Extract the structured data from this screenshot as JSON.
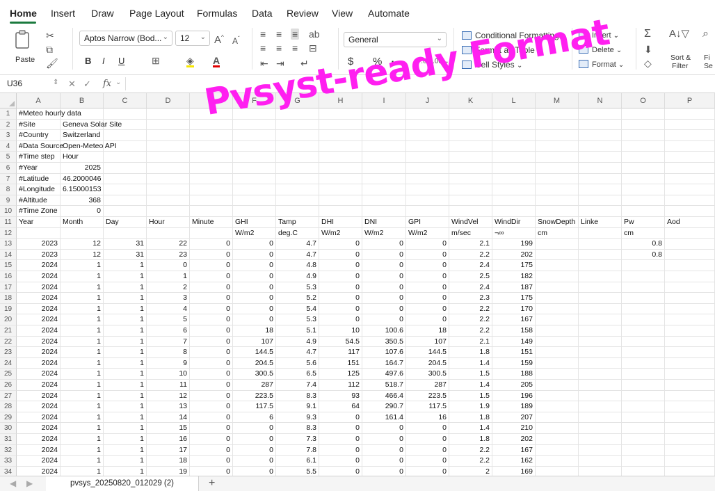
{
  "menu_tabs": [
    "Home",
    "Insert",
    "Draw",
    "Page Layout",
    "Formulas",
    "Data",
    "Review",
    "View",
    "Automate"
  ],
  "ribbon": {
    "paste_label": "Paste",
    "font_name": "Aptos Narrow (Bod...",
    "font_size": "12",
    "bold": "B",
    "italic": "I",
    "underline": "U",
    "number_format": "General",
    "currency": "$",
    "percent": "%",
    "comma": "։",
    "conditional_formatting": "Conditional Formatting",
    "format_as_table": "Format as Table",
    "cell_styles": "Cell Styles",
    "insert": "Insert",
    "delete": "Delete",
    "format": "Format",
    "sort_filter_1": "Sort &",
    "sort_filter_2": "Filter",
    "find_1": "Fi",
    "find_2": "Se"
  },
  "formula_bar": {
    "name_box": "U36",
    "fx": "fx",
    "formula": ""
  },
  "columns": [
    "A",
    "B",
    "C",
    "D",
    "E",
    "F",
    "G",
    "H",
    "I",
    "J",
    "K",
    "L",
    "M",
    "N",
    "O",
    "P"
  ],
  "rows": [
    {
      "n": "1",
      "cells": [
        "#Meteo hourly data",
        "",
        "",
        "",
        "",
        "",
        "",
        "",
        "",
        "",
        "",
        "",
        "",
        "",
        "",
        ""
      ]
    },
    {
      "n": "2",
      "cells": [
        "#Site",
        "Geneva Solar Site",
        "",
        "",
        "",
        "",
        "",
        "",
        "",
        "",
        "",
        "",
        "",
        "",
        "",
        ""
      ]
    },
    {
      "n": "3",
      "cells": [
        "#Country",
        "Switzerland",
        "",
        "",
        "",
        "",
        "",
        "",
        "",
        "",
        "",
        "",
        "",
        "",
        "",
        ""
      ]
    },
    {
      "n": "4",
      "cells": [
        "#Data Source",
        "Open-Meteo API",
        "",
        "",
        "",
        "",
        "",
        "",
        "",
        "",
        "",
        "",
        "",
        "",
        "",
        ""
      ]
    },
    {
      "n": "5",
      "cells": [
        "#Time step",
        "Hour",
        "",
        "",
        "",
        "",
        "",
        "",
        "",
        "",
        "",
        "",
        "",
        "",
        "",
        ""
      ]
    },
    {
      "n": "6",
      "cells": [
        "#Year",
        "2025",
        "",
        "",
        "",
        "",
        "",
        "",
        "",
        "",
        "",
        "",
        "",
        "",
        "",
        ""
      ]
    },
    {
      "n": "7",
      "cells": [
        "#Latitude",
        "46.2000046",
        "",
        "",
        "",
        "",
        "",
        "",
        "",
        "",
        "",
        "",
        "",
        "",
        "",
        ""
      ]
    },
    {
      "n": "8",
      "cells": [
        "#Longitude",
        "6.15000153",
        "",
        "",
        "",
        "",
        "",
        "",
        "",
        "",
        "",
        "",
        "",
        "",
        "",
        ""
      ]
    },
    {
      "n": "9",
      "cells": [
        "#Altitude",
        "368",
        "",
        "",
        "",
        "",
        "",
        "",
        "",
        "",
        "",
        "",
        "",
        "",
        "",
        ""
      ]
    },
    {
      "n": "10",
      "cells": [
        "#Time Zone",
        "0",
        "",
        "",
        "",
        "",
        "",
        "",
        "",
        "",
        "",
        "",
        "",
        "",
        "",
        ""
      ]
    },
    {
      "n": "11",
      "cells": [
        "Year",
        "Month",
        "Day",
        "Hour",
        "Minute",
        "GHI",
        "Tamp",
        "DHI",
        "DNI",
        "GPI",
        "WindVel",
        "WindDir",
        "SnowDepth",
        "Linke",
        "Pw",
        "Aod"
      ]
    },
    {
      "n": "12",
      "cells": [
        "",
        "",
        "",
        "",
        "",
        "W/m2",
        "deg.C",
        "W/m2",
        "W/m2",
        "W/m2",
        "m/sec",
        "¬∞",
        "cm",
        "",
        "cm",
        ""
      ]
    },
    {
      "n": "13",
      "cells": [
        "2023",
        "12",
        "31",
        "22",
        "0",
        "0",
        "4.7",
        "0",
        "0",
        "0",
        "2.1",
        "199",
        "",
        "",
        "0.8",
        ""
      ]
    },
    {
      "n": "14",
      "cells": [
        "2023",
        "12",
        "31",
        "23",
        "0",
        "0",
        "4.7",
        "0",
        "0",
        "0",
        "2.2",
        "202",
        "",
        "",
        "0.8",
        ""
      ]
    },
    {
      "n": "15",
      "cells": [
        "2024",
        "1",
        "1",
        "0",
        "0",
        "0",
        "4.8",
        "0",
        "0",
        "0",
        "2.4",
        "175",
        "",
        "",
        "",
        ""
      ]
    },
    {
      "n": "16",
      "cells": [
        "2024",
        "1",
        "1",
        "1",
        "0",
        "0",
        "4.9",
        "0",
        "0",
        "0",
        "2.5",
        "182",
        "",
        "",
        "",
        ""
      ]
    },
    {
      "n": "17",
      "cells": [
        "2024",
        "1",
        "1",
        "2",
        "0",
        "0",
        "5.3",
        "0",
        "0",
        "0",
        "2.4",
        "187",
        "",
        "",
        "",
        ""
      ]
    },
    {
      "n": "18",
      "cells": [
        "2024",
        "1",
        "1",
        "3",
        "0",
        "0",
        "5.2",
        "0",
        "0",
        "0",
        "2.3",
        "175",
        "",
        "",
        "",
        ""
      ]
    },
    {
      "n": "19",
      "cells": [
        "2024",
        "1",
        "1",
        "4",
        "0",
        "0",
        "5.4",
        "0",
        "0",
        "0",
        "2.2",
        "170",
        "",
        "",
        "",
        ""
      ]
    },
    {
      "n": "20",
      "cells": [
        "2024",
        "1",
        "1",
        "5",
        "0",
        "0",
        "5.3",
        "0",
        "0",
        "0",
        "2.2",
        "167",
        "",
        "",
        "",
        ""
      ]
    },
    {
      "n": "21",
      "cells": [
        "2024",
        "1",
        "1",
        "6",
        "0",
        "18",
        "5.1",
        "10",
        "100.6",
        "18",
        "2.2",
        "158",
        "",
        "",
        "",
        ""
      ]
    },
    {
      "n": "22",
      "cells": [
        "2024",
        "1",
        "1",
        "7",
        "0",
        "107",
        "4.9",
        "54.5",
        "350.5",
        "107",
        "2.1",
        "149",
        "",
        "",
        "",
        ""
      ]
    },
    {
      "n": "23",
      "cells": [
        "2024",
        "1",
        "1",
        "8",
        "0",
        "144.5",
        "4.7",
        "117",
        "107.6",
        "144.5",
        "1.8",
        "151",
        "",
        "",
        "",
        ""
      ]
    },
    {
      "n": "24",
      "cells": [
        "2024",
        "1",
        "1",
        "9",
        "0",
        "204.5",
        "5.6",
        "151",
        "164.7",
        "204.5",
        "1.4",
        "159",
        "",
        "",
        "",
        ""
      ]
    },
    {
      "n": "25",
      "cells": [
        "2024",
        "1",
        "1",
        "10",
        "0",
        "300.5",
        "6.5",
        "125",
        "497.6",
        "300.5",
        "1.5",
        "188",
        "",
        "",
        "",
        ""
      ]
    },
    {
      "n": "26",
      "cells": [
        "2024",
        "1",
        "1",
        "11",
        "0",
        "287",
        "7.4",
        "112",
        "518.7",
        "287",
        "1.4",
        "205",
        "",
        "",
        "",
        ""
      ]
    },
    {
      "n": "27",
      "cells": [
        "2024",
        "1",
        "1",
        "12",
        "0",
        "223.5",
        "8.3",
        "93",
        "466.4",
        "223.5",
        "1.5",
        "196",
        "",
        "",
        "",
        ""
      ]
    },
    {
      "n": "28",
      "cells": [
        "2024",
        "1",
        "1",
        "13",
        "0",
        "117.5",
        "9.1",
        "64",
        "290.7",
        "117.5",
        "1.9",
        "189",
        "",
        "",
        "",
        ""
      ]
    },
    {
      "n": "29",
      "cells": [
        "2024",
        "1",
        "1",
        "14",
        "0",
        "6",
        "9.3",
        "0",
        "161.4",
        "16",
        "1.8",
        "207",
        "",
        "",
        "",
        ""
      ]
    },
    {
      "n": "30",
      "cells": [
        "2024",
        "1",
        "1",
        "15",
        "0",
        "0",
        "8.3",
        "0",
        "0",
        "0",
        "1.4",
        "210",
        "",
        "",
        "",
        ""
      ]
    },
    {
      "n": "31",
      "cells": [
        "2024",
        "1",
        "1",
        "16",
        "0",
        "0",
        "7.3",
        "0",
        "0",
        "0",
        "1.8",
        "202",
        "",
        "",
        "",
        ""
      ]
    },
    {
      "n": "32",
      "cells": [
        "2024",
        "1",
        "1",
        "17",
        "0",
        "0",
        "7.8",
        "0",
        "0",
        "0",
        "2.2",
        "167",
        "",
        "",
        "",
        ""
      ]
    },
    {
      "n": "33",
      "cells": [
        "2024",
        "1",
        "1",
        "18",
        "0",
        "0",
        "6.1",
        "0",
        "0",
        "0",
        "2.2",
        "162",
        "",
        "",
        "",
        ""
      ]
    },
    {
      "n": "34",
      "cells": [
        "2024",
        "1",
        "1",
        "19",
        "0",
        "0",
        "5.5",
        "0",
        "0",
        "0",
        "2",
        "169",
        "",
        "",
        "",
        ""
      ]
    }
  ],
  "sheet_tab": "pvsys_20250820_012029 (2)",
  "add_sheet": "+",
  "overlay_text": "Pvsyst-ready Format"
}
